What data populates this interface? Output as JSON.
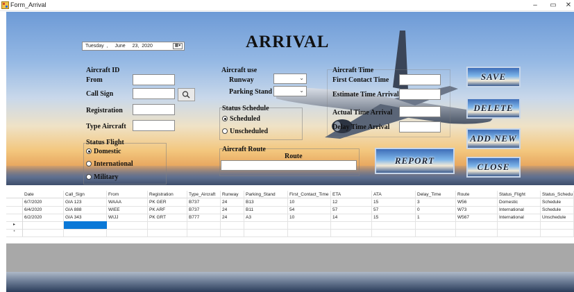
{
  "window": {
    "title": "Form_Arrival",
    "minimize_glyph": "–",
    "maximize_glyph": "▭",
    "close_glyph": "✕"
  },
  "header": {
    "title": "ARRIVAL",
    "date": {
      "weekday": "Tuesday",
      "sep": ",",
      "month": "June",
      "day": "23,",
      "year": "2020",
      "picker_glyph": "▦▾"
    }
  },
  "aircraft_id": {
    "heading": "Aircraft ID",
    "from_label": "From",
    "from_value": "",
    "call_sign_label": "Call Sign",
    "call_sign_value": "",
    "registration_label": "Registration",
    "registration_value": "",
    "type_aircraft_label": "Type Aircraft",
    "type_aircraft_value": ""
  },
  "aircraft_use": {
    "heading": "Aircraft use",
    "runway_label": "Runway",
    "runway_value": "",
    "parking_stand_label": "Parking Stand",
    "parking_stand_value": ""
  },
  "status_schedule": {
    "heading": "Status Schedule",
    "options": [
      {
        "label": "Scheduled",
        "checked": true
      },
      {
        "label": "Unscheduled",
        "checked": false
      }
    ]
  },
  "status_flight": {
    "heading": "Status Flight",
    "options": [
      {
        "label": "Domestic",
        "checked": true
      },
      {
        "label": "International",
        "checked": false
      },
      {
        "label": "Military",
        "checked": false
      }
    ]
  },
  "aircraft_time": {
    "heading": "Aircraft Time",
    "first_contact_label": "First Contact Time",
    "first_contact_value": "",
    "estimate_label": "Estimate Time Arrival",
    "estimate_value": "",
    "actual_label": "Actual Time Arrival",
    "actual_value": "",
    "delay_label": "Delay Time Arrival",
    "delay_value": ""
  },
  "aircraft_route": {
    "heading": "Aircraft Route",
    "route_label": "Route",
    "route_value": ""
  },
  "buttons": {
    "save": "SAVE",
    "delete": "DELETE",
    "add_new": "ADD NEW",
    "close": "CLOSE",
    "report": "REPORT"
  },
  "grid": {
    "columns": [
      "Date",
      "Call_Sign",
      "From",
      "Registration",
      "Type_Aircraft",
      "Runway",
      "Parking_Stand",
      "First_Contact_Time",
      "ETA",
      "ATA",
      "Delay_Time",
      "Route",
      "Status_Flight",
      "Status_Schedu"
    ],
    "rows": [
      [
        "6/7/2020",
        "GIA 123",
        "WAAA",
        "PK GER",
        "B737",
        "24",
        "B13",
        "10",
        "12",
        "15",
        "3",
        "W56",
        "Domestic",
        "Schedule"
      ],
      [
        "6/4/2020",
        "GIA 888",
        "WIEE",
        "PK ARF",
        "B737",
        "24",
        "B11",
        "54",
        "57",
        "57",
        "0",
        "W73",
        "International",
        "Schedule"
      ],
      [
        "6/2/2020",
        "GIA 343",
        "WIJJ",
        "PK GRT",
        "B777",
        "24",
        "A3",
        "10",
        "14",
        "15",
        "1",
        "W567",
        "International",
        "Unschedule"
      ]
    ],
    "current_row_marker": "▸",
    "new_row_marker": "*"
  },
  "colors": {
    "selection": "#0a78d7",
    "grid_background": "#ffffff",
    "empty_area": "#a8a8a8"
  }
}
